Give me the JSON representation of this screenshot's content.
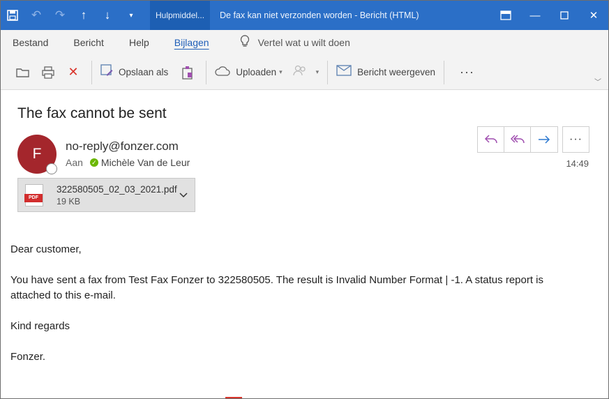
{
  "titlebar": {
    "tag": "Hulpmiddel...",
    "title": "De fax kan niet verzonden worden - Bericht (HTML)"
  },
  "menu": {
    "items": [
      "Bestand",
      "Bericht",
      "Help",
      "Bijlagen"
    ],
    "tell_me": "Vertel wat u wilt doen"
  },
  "ribbon": {
    "save_as": "Opslaan als",
    "upload": "Uploaden",
    "show_message": "Bericht weergeven"
  },
  "email": {
    "subject": "The fax cannot be sent",
    "avatar_initial": "F",
    "from": "no-reply@fonzer.com",
    "to_label": "Aan",
    "to_name": "Michèle Van de Leur",
    "time": "14:49"
  },
  "attachment": {
    "badge": "PDF",
    "name": "322580505_02_03_2021.pdf",
    "size": "19 KB"
  },
  "body": {
    "greeting": "Dear customer,",
    "message": "You have sent a fax from Test Fax Fonzer to 322580505. The result is Invalid Number Format | -1. A status report is attached to this e-mail.",
    "closing": "Kind regards",
    "signature": "Fonzer."
  },
  "colors": {
    "titlebar": "#2b6fc7",
    "avatar": "#a4262c",
    "reply_icons": "#a04fb0",
    "forward_icon": "#2b78d0",
    "pdf_badge": "#d22d2d"
  }
}
